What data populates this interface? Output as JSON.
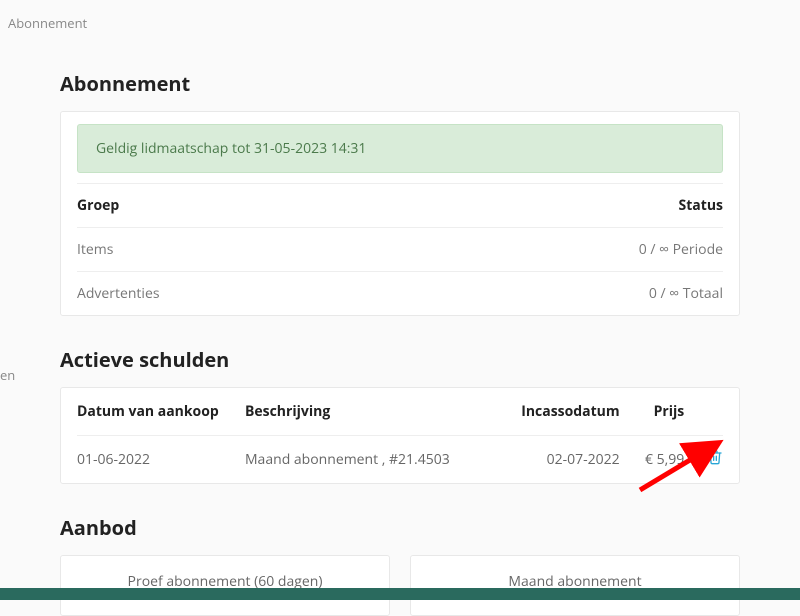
{
  "breadcrumb": "Abonnement",
  "edge_text": "en",
  "abonnement": {
    "heading": "Abonnement",
    "alert": "Geldig lidmaatschap tot 31-05-2023 14:31",
    "th_group": "Groep",
    "th_status": "Status",
    "rows": [
      {
        "label": "Items",
        "value": "0 / ∞ Periode"
      },
      {
        "label": "Advertenties",
        "value": "0 / ∞ Totaal"
      }
    ]
  },
  "debts": {
    "heading": "Actieve schulden",
    "th_date": "Datum van aankoop",
    "th_desc": "Beschrijving",
    "th_inc": "Incassodatum",
    "th_price": "Prijs",
    "row": {
      "date": "01-06-2022",
      "desc": "Maand abonnement , #21.4503",
      "inc": "02-07-2022",
      "price": "€ 5,99"
    }
  },
  "offers": {
    "heading": "Aanbod",
    "trial": "Proef abonnement (60 dagen)",
    "monthly": "Maand abonnement"
  }
}
